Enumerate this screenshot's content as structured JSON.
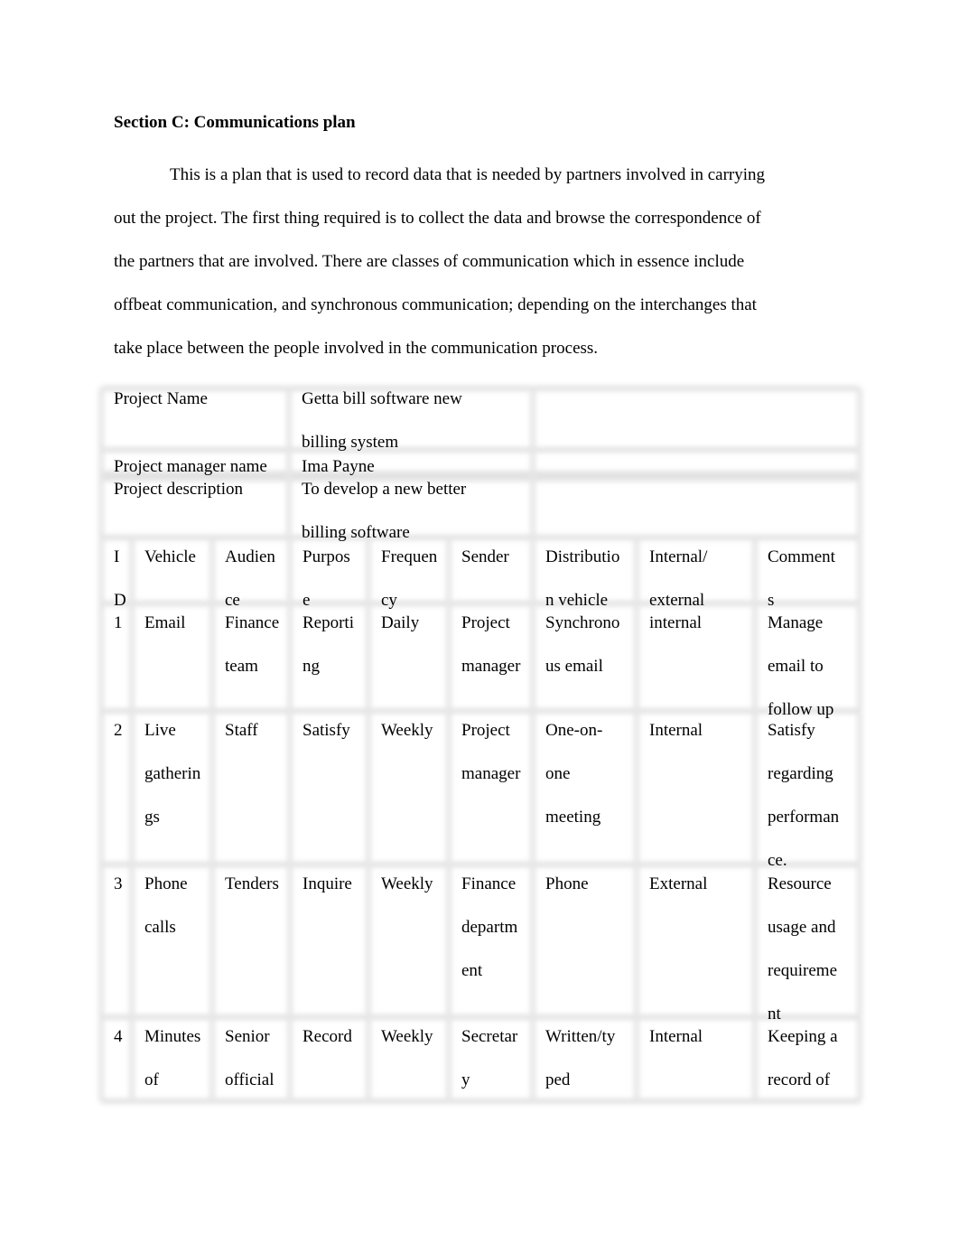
{
  "document": {
    "heading": "Section C: Communications plan",
    "paragraph_lines": [
      "This is a plan that is used to record data that is needed by partners involved in carrying",
      "out the project. The first thing required is to collect the data and browse the correspondence of",
      "the partners that are involved. There are classes of communication which in essence include",
      "offbeat communication, and synchronous communication; depending on the interchanges that",
      "take place between the people involved in the communication process."
    ]
  },
  "project_info": {
    "rows": [
      {
        "label": "Project Name",
        "value_lines": [
          "Getta bill software new",
          "billing system"
        ]
      },
      {
        "label": "Project manager name",
        "value_lines": [
          "Ima Payne"
        ]
      },
      {
        "label": "Project description",
        "value_lines": [
          "To develop a new better",
          "billing software"
        ]
      }
    ]
  },
  "comm_table": {
    "headers": [
      [
        "I",
        "D"
      ],
      [
        "Vehicle"
      ],
      [
        "Audien",
        "ce"
      ],
      [
        "Purpos",
        "e"
      ],
      [
        "Frequen",
        "cy"
      ],
      [
        "Sender"
      ],
      [
        "Distributio",
        "n vehicle"
      ],
      [
        "Internal/",
        "external"
      ],
      [
        "Comment",
        "s"
      ]
    ],
    "rows": [
      [
        [
          "1"
        ],
        [
          "Email"
        ],
        [
          "Finance",
          "team"
        ],
        [
          "Reporti",
          "ng"
        ],
        [
          "Daily"
        ],
        [
          "Project",
          "manager"
        ],
        [
          "Synchrono",
          "us email"
        ],
        [
          "internal"
        ],
        [
          "Manage",
          "email to",
          "follow up"
        ]
      ],
      [
        [
          "2"
        ],
        [
          "Live",
          "gatherin",
          "gs"
        ],
        [
          "Staff"
        ],
        [
          "Satisfy"
        ],
        [
          "Weekly"
        ],
        [
          "Project",
          "manager"
        ],
        [
          "One-on-",
          "one",
          "meeting"
        ],
        [
          "Internal"
        ],
        [
          "Satisfy",
          "regarding",
          "performan",
          "ce."
        ]
      ],
      [
        [
          "3"
        ],
        [
          "Phone",
          "calls"
        ],
        [
          "Tenders"
        ],
        [
          "Inquire"
        ],
        [
          "Weekly"
        ],
        [
          "Finance",
          "departm",
          "ent"
        ],
        [
          "Phone"
        ],
        [
          "External"
        ],
        [
          "Resource",
          "usage and",
          "requireme",
          "nt"
        ]
      ],
      [
        [
          "4"
        ],
        [
          "Minutes",
          "of"
        ],
        [
          "Senior",
          "official"
        ],
        [
          "Record"
        ],
        [
          "Weekly"
        ],
        [
          "Secretar",
          "y"
        ],
        [
          "Written/ty",
          "ped"
        ],
        [
          "Internal"
        ],
        [
          "Keeping a",
          "record of"
        ]
      ]
    ]
  }
}
